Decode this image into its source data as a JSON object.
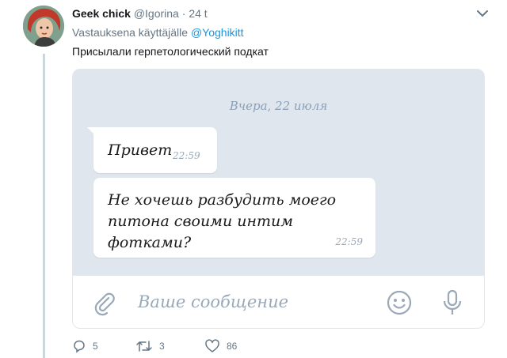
{
  "tweet": {
    "author_name": "Geek chick",
    "author_handle": "@Igorina",
    "separator": "·",
    "time": "24 t",
    "reply_prefix": "Vastauksena käyttäjälle",
    "reply_to": "@Yoghikitt",
    "text": "Присылали герпетологический подкат"
  },
  "chat": {
    "date": "Вчера, 22 июля",
    "messages": [
      {
        "text": "Привет",
        "time": "22:59"
      },
      {
        "text": "Не хочешь разбудить моего питона своими интим фотками?",
        "time": "22:59"
      }
    ],
    "input_placeholder": "Ваше сообщение"
  },
  "actions": {
    "replies": "5",
    "retweets": "3",
    "likes": "86"
  },
  "icons": [
    "chevron-down-icon",
    "paperclip-icon",
    "smiley-icon",
    "microphone-icon",
    "reply-icon",
    "retweet-icon",
    "heart-icon"
  ],
  "colors": {
    "link": "#1b95e0",
    "muted": "#657786",
    "chat_bg": "#dfe6ee"
  }
}
